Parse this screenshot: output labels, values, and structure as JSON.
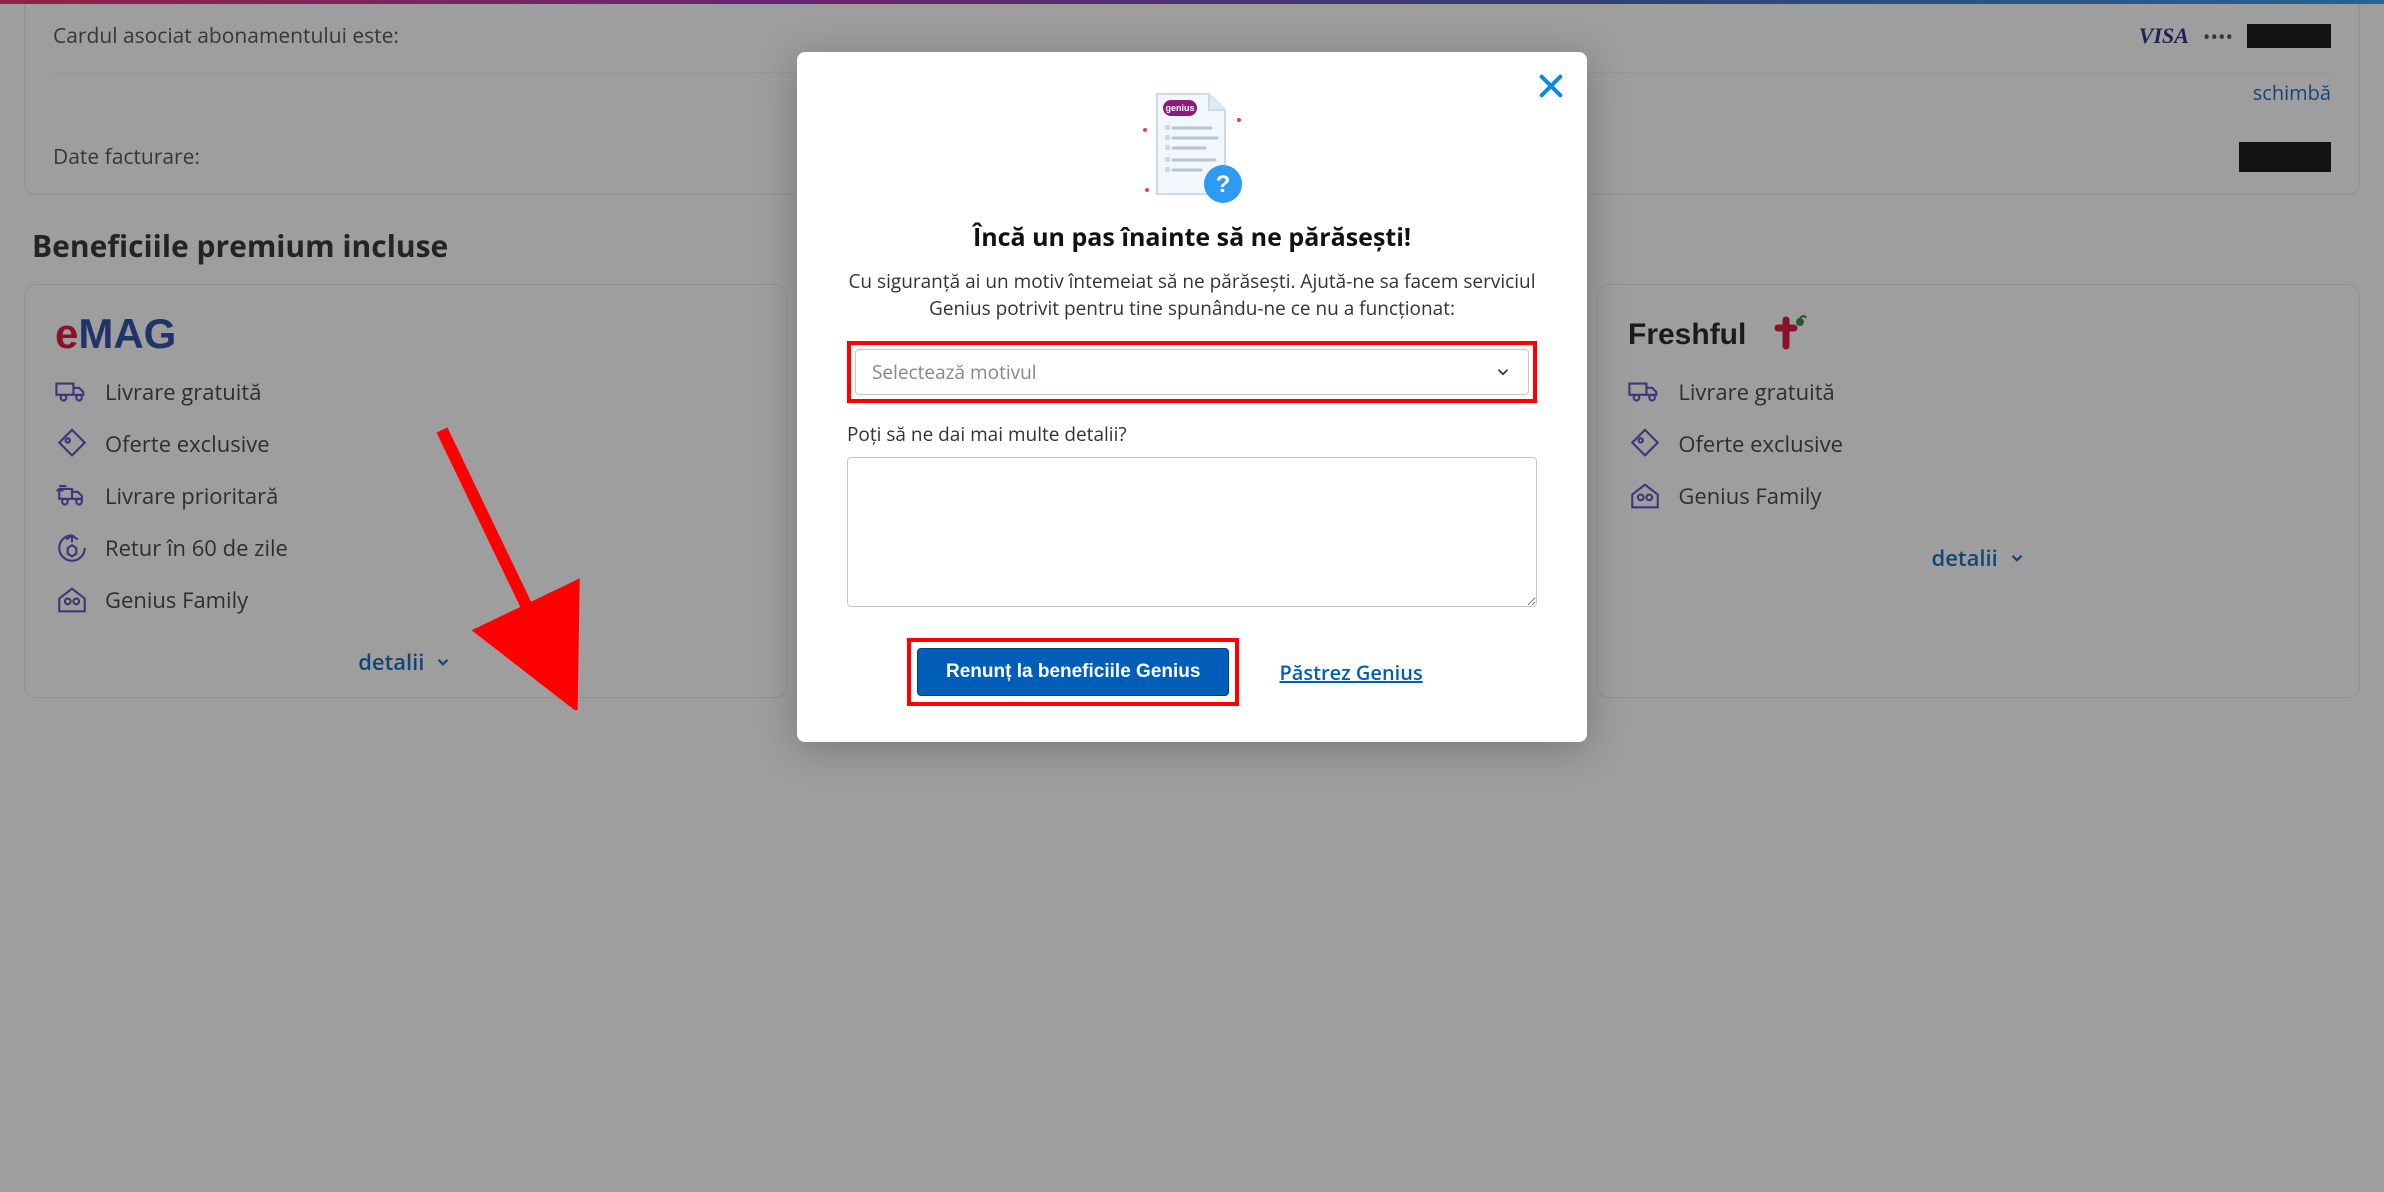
{
  "background": {
    "card_row_label": "Cardul asociat abonamentului este:",
    "card_brand": "VISA",
    "card_mask": "••••",
    "card_change": "schimbă",
    "billing_label": "Date facturare:",
    "benefits_section_title": "Beneficiile premium incluse",
    "card_emag": {
      "logo_text": "eMAG",
      "items": [
        "Livrare gratuită",
        "Oferte exclusive",
        "Livrare prioritară",
        "Retur în 60 de zile",
        "Genius Family"
      ],
      "details": "detalii"
    },
    "card_freshful": {
      "logo_text": "Freshful",
      "items": [
        "Livrare gratuită",
        "Oferte exclusive",
        "Genius Family"
      ],
      "details": "detalii"
    }
  },
  "modal": {
    "title": "Încă un pas înainte să ne părăsești!",
    "lead": "Cu siguranță ai un motiv întemeiat să ne părăsești. Ajută-ne sa facem serviciul Genius potrivit pentru tine spunându-ne ce nu a funcționat:",
    "select_placeholder": "Selectează motivul",
    "details_label": "Poți să ne dai mai multe detalii?",
    "btn_cancel": "Renunț la beneficiile Genius",
    "link_keep": "Păstrez Genius"
  },
  "colors": {
    "accent": "#005eb8",
    "annotation": "#ff0000"
  }
}
